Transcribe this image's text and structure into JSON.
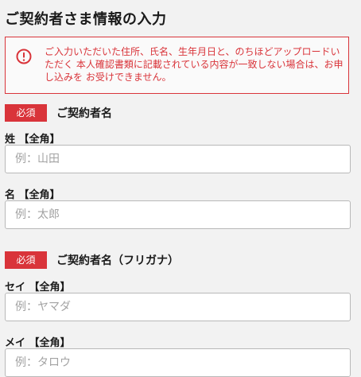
{
  "page": {
    "title": "ご契約者さま情報の入力"
  },
  "warning": {
    "message": "ご入力いただいた住所、氏名、生年月日と、のちほどアップロードいただく 本人確認書類に記載されている内容が一致しない場合は、お申し込みを お受けできません。",
    "icon": "exclamation-circle-icon",
    "color": "#d9343a"
  },
  "sections": [
    {
      "badge": "必須",
      "label": "ご契約者名",
      "fields": [
        {
          "label": "姓 【全角】",
          "placeholder": "例：山田",
          "value": ""
        },
        {
          "label": "名 【全角】",
          "placeholder": "例：太郎",
          "value": ""
        }
      ]
    },
    {
      "badge": "必須",
      "label": "ご契約者名（フリガナ）",
      "fields": [
        {
          "label": "セイ 【全角】",
          "placeholder": "例：ヤマダ",
          "value": ""
        },
        {
          "label": "メイ 【全角】",
          "placeholder": "例：タロウ",
          "value": ""
        }
      ]
    }
  ],
  "colors": {
    "accent": "#d9343a",
    "background": "#f2f2f2",
    "input_border": "#b8b8b8"
  }
}
